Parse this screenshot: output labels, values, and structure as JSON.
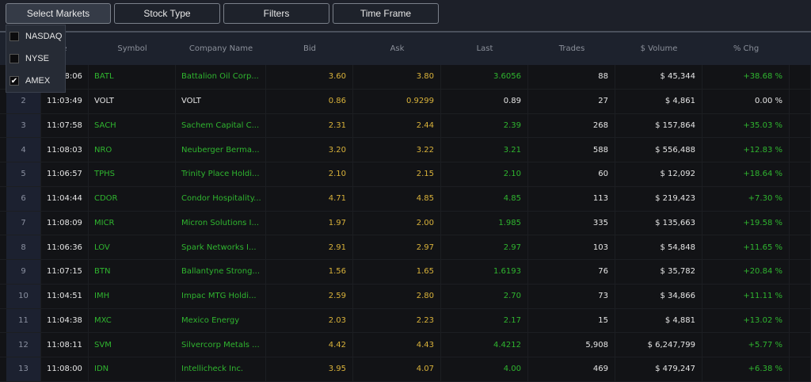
{
  "toolbar": {
    "buttons": [
      "Select Markets",
      "Stock Type",
      "Filters",
      "Time Frame"
    ]
  },
  "markets_dropdown": [
    {
      "label": "NASDAQ",
      "checked": false
    },
    {
      "label": "NYSE",
      "checked": false
    },
    {
      "label": "AMEX",
      "checked": true
    }
  ],
  "columns": [
    "",
    "Time",
    "Symbol",
    "Company Name",
    "Bid",
    "Ask",
    "Last",
    "Trades",
    "$ Volume",
    "% Chg"
  ],
  "colors": {
    "green": "#2fb52f",
    "yellow": "#d9b23a",
    "white": "#e6e6e6"
  },
  "rows": [
    [
      "1",
      "11:08:06",
      "BATL",
      "Battalion Oil Corp...",
      "3.60",
      "3.80",
      "3.6056",
      "88",
      "$ 45,344",
      "+38.68 %"
    ],
    [
      "2",
      "11:03:49",
      "VOLT",
      "VOLT",
      "0.86",
      "0.9299",
      "0.89",
      "27",
      "$ 4,861",
      "0.00 %"
    ],
    [
      "3",
      "11:07:58",
      "SACH",
      "Sachem Capital C...",
      "2.31",
      "2.44",
      "2.39",
      "268",
      "$ 157,864",
      "+35.03 %"
    ],
    [
      "4",
      "11:08:03",
      "NRO",
      "Neuberger Berma...",
      "3.20",
      "3.22",
      "3.21",
      "588",
      "$ 556,488",
      "+12.83 %"
    ],
    [
      "5",
      "11:06:57",
      "TPHS",
      "Trinity Place Holdi...",
      "2.10",
      "2.15",
      "2.10",
      "60",
      "$ 12,092",
      "+18.64 %"
    ],
    [
      "6",
      "11:04:44",
      "CDOR",
      "Condor Hospitality...",
      "4.71",
      "4.85",
      "4.85",
      "113",
      "$ 219,423",
      "+7.30 %"
    ],
    [
      "7",
      "11:08:09",
      "MICR",
      "Micron Solutions I...",
      "1.97",
      "2.00",
      "1.985",
      "335",
      "$ 135,663",
      "+19.58 %"
    ],
    [
      "8",
      "11:06:36",
      "LOV",
      "Spark Networks I...",
      "2.91",
      "2.97",
      "2.97",
      "103",
      "$ 54,848",
      "+11.65 %"
    ],
    [
      "9",
      "11:07:15",
      "BTN",
      "Ballantyne Strong...",
      "1.56",
      "1.65",
      "1.6193",
      "76",
      "$ 35,782",
      "+20.84 %"
    ],
    [
      "10",
      "11:04:51",
      "IMH",
      "Impac MTG Holdi...",
      "2.59",
      "2.80",
      "2.70",
      "73",
      "$ 34,866",
      "+11.11 %"
    ],
    [
      "11",
      "11:04:38",
      "MXC",
      "Mexico Energy",
      "2.03",
      "2.23",
      "2.17",
      "15",
      "$ 4,881",
      "+13.02 %"
    ],
    [
      "12",
      "11:08:11",
      "SVM",
      "Silvercorp Metals ...",
      "4.42",
      "4.43",
      "4.4212",
      "5,908",
      "$ 6,247,799",
      "+5.77 %"
    ],
    [
      "13",
      "11:08:00",
      "IDN",
      "Intellicheck Inc.",
      "3.95",
      "4.07",
      "4.00",
      "469",
      "$ 479,247",
      "+6.38 %"
    ]
  ]
}
